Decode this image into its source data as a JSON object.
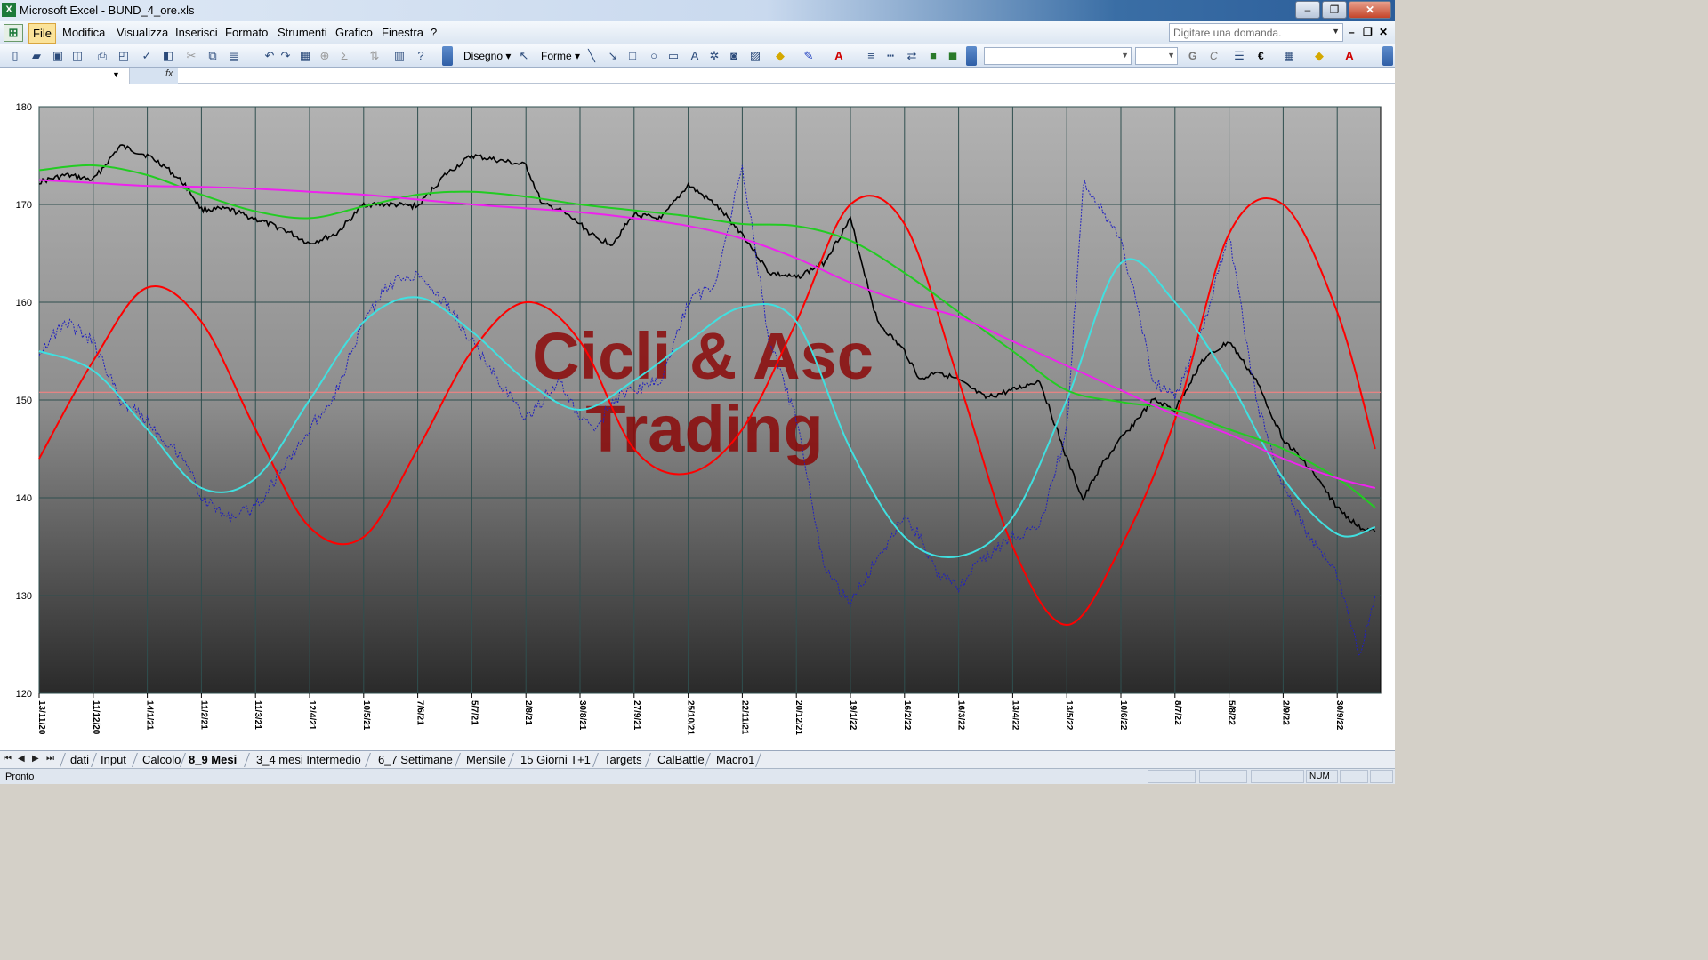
{
  "window": {
    "title": "Microsoft Excel - BUND_4_ore.xls",
    "minimize": "–",
    "restore": "❐",
    "close": "✕"
  },
  "menubar": {
    "items": [
      "File",
      "Modifica",
      "Visualizza",
      "Inserisci",
      "Formato",
      "Strumenti",
      "Grafico",
      "Finestra",
      "?"
    ],
    "help_placeholder": "Digitare una domanda.",
    "doc_min": "–",
    "doc_restore": "❐",
    "doc_close": "✕"
  },
  "toolbar": {
    "disegno_label": "Disegno",
    "forme_label": "Forme",
    "icons": [
      "new-icon",
      "open-icon",
      "save-icon",
      "permission-icon",
      "print-icon",
      "print-preview-icon",
      "spelling-icon",
      "research-icon",
      "cut-icon",
      "copy-icon",
      "paste-icon",
      "undo-icon",
      "redo-icon",
      "chart-object-icon",
      "hyperlink-icon",
      "autosum-icon",
      "sort-icon",
      "chart-wizard-icon",
      "help-icon"
    ],
    "bold_label": "G",
    "italic_label": "C",
    "euro_label": "€"
  },
  "formula_bar": {
    "fx_label": "fx"
  },
  "chart_data": {
    "type": "line",
    "title": "",
    "watermark": [
      "Cicli & Asc",
      "Trading"
    ],
    "ylim": [
      120,
      180
    ],
    "yticks": [
      120,
      130,
      140,
      150,
      160,
      170,
      180
    ],
    "xlabel": "",
    "ylabel": "",
    "x_tick_labels": [
      "13/11/20",
      "11/12/20",
      "14/1/21",
      "11/2/21",
      "11/3/21",
      "12/4/21",
      "10/5/21",
      "7/6/21",
      "5/7/21",
      "2/8/21",
      "30/8/21",
      "27/9/21",
      "25/10/21",
      "22/11/21",
      "20/12/21",
      "19/1/22",
      "16/2/22",
      "16/3/22",
      "13/4/22",
      "13/5/22",
      "10/6/22",
      "8/7/22",
      "5/8/22",
      "2/9/22",
      "30/9/22"
    ],
    "reference_line": {
      "name": "level",
      "value": 150.8,
      "color": "#ff8080"
    },
    "grid": true,
    "series": [
      {
        "color": "#000000",
        "style": "price",
        "x": [
          0,
          0.5,
          1,
          1.5,
          2,
          2.3,
          2.7,
          3,
          3.5,
          4,
          4.5,
          5,
          5.5,
          6,
          6.5,
          7,
          7.5,
          8,
          8.5,
          9,
          9.3,
          9.6,
          10,
          10.3,
          10.6,
          11,
          11.5,
          12,
          12.5,
          13,
          13.5,
          14,
          14.5,
          15,
          15.5,
          16,
          16.3,
          16.6,
          17,
          17.5,
          18,
          18.5,
          19,
          19.3,
          19.6,
          20,
          20.3,
          20.6,
          21,
          21.5,
          22,
          22.5,
          23,
          23.5,
          24,
          24.4,
          24.7
        ],
        "values": [
          172.3,
          173,
          172.5,
          176,
          175,
          174,
          172,
          169.5,
          169.5,
          168.5,
          167.5,
          166,
          167,
          170,
          170,
          169.8,
          173,
          175,
          174.5,
          174,
          170,
          169.5,
          168,
          166.5,
          166,
          169,
          168.5,
          172,
          170,
          167,
          163,
          162.5,
          164,
          168.5,
          158,
          155,
          152,
          153,
          152,
          150.2,
          151,
          152,
          144,
          139.8,
          143,
          146,
          148,
          150,
          149,
          154,
          156,
          152,
          146,
          143,
          139,
          137,
          136.5
        ]
      },
      {
        "color": "#2020c0",
        "style": "dotted-oscillator",
        "x": [
          0,
          0.5,
          1,
          1.5,
          2,
          2.3,
          2.7,
          3,
          3.5,
          4,
          4.5,
          5,
          5.5,
          6,
          6.5,
          7,
          7.5,
          8,
          8.5,
          9,
          9.3,
          9.6,
          10,
          10.3,
          10.6,
          11,
          11.5,
          12,
          12.5,
          13,
          13.5,
          14,
          14.5,
          15,
          15.5,
          16,
          16.3,
          16.6,
          17,
          17.5,
          18,
          18.5,
          19,
          19.3,
          19.6,
          20,
          20.3,
          20.6,
          21,
          21.5,
          22,
          22.5,
          23,
          23.5,
          24,
          24.4,
          24.7
        ],
        "values": [
          155,
          158,
          156,
          150,
          148,
          146,
          144,
          140,
          138,
          139,
          143,
          147,
          151,
          158,
          162,
          163,
          160,
          156,
          152,
          148,
          150,
          152,
          148,
          147,
          150,
          151,
          152,
          160,
          162,
          174,
          156,
          148,
          133,
          129,
          134,
          138,
          136,
          132,
          131,
          134,
          136,
          137,
          147,
          172,
          170,
          166,
          160,
          152,
          150,
          157,
          167,
          150,
          141,
          136,
          132,
          124,
          130
        ]
      },
      {
        "color": "#ff0000",
        "style": "cycle",
        "x": [
          0,
          1,
          2,
          3,
          4,
          5,
          6,
          7,
          8,
          9,
          10,
          11,
          12,
          13,
          14,
          15,
          16,
          17,
          18,
          19,
          20,
          21,
          22,
          23,
          24,
          24.7
        ],
        "values": [
          144,
          154,
          161.5,
          158,
          147,
          137,
          136,
          145,
          155,
          160,
          156,
          145,
          142.5,
          147,
          158,
          170,
          168,
          152,
          135,
          127,
          135,
          148,
          167,
          170,
          159,
          145
        ]
      },
      {
        "color": "#40e0e0",
        "style": "smooth",
        "x": [
          0,
          1,
          2,
          3,
          4,
          5,
          6,
          7,
          8,
          9,
          10,
          11,
          12,
          13,
          14,
          15,
          16,
          17,
          18,
          19,
          20,
          21,
          22,
          23,
          24,
          24.7
        ],
        "values": [
          155,
          153,
          147,
          141,
          142,
          150,
          158,
          160.5,
          157,
          152,
          149,
          152,
          156,
          159.5,
          158,
          145,
          136,
          134,
          138,
          150,
          164,
          160,
          152,
          142,
          136.3,
          137
        ]
      },
      {
        "color": "#22cc22",
        "style": "smooth",
        "x": [
          0,
          1,
          2,
          3,
          4,
          5,
          6,
          7,
          8,
          9,
          10,
          11,
          12,
          13,
          14,
          15,
          16,
          17,
          18,
          19,
          20,
          21,
          22,
          23,
          24,
          24.7
        ],
        "values": [
          173.5,
          174,
          173,
          171,
          169.3,
          168.6,
          169.8,
          171,
          171.3,
          170.8,
          170,
          169.4,
          168.8,
          168,
          167.8,
          166.3,
          163,
          159,
          155,
          151,
          149.8,
          149,
          147,
          145,
          142,
          139
        ]
      },
      {
        "color": "#ee22ee",
        "style": "smooth",
        "x": [
          0,
          1,
          2,
          3,
          4,
          5,
          6,
          7,
          8,
          9,
          10,
          11,
          12,
          13,
          14,
          15,
          16,
          17,
          18,
          19,
          20,
          21,
          22,
          23,
          24,
          24.7
        ],
        "values": [
          172.5,
          172.2,
          171.9,
          171.8,
          171.6,
          171.3,
          171,
          170.5,
          170,
          169.6,
          169.2,
          168.6,
          167.8,
          166.5,
          164.5,
          162,
          160,
          158.5,
          156,
          153.5,
          151,
          148.5,
          146.5,
          144,
          142,
          141
        ]
      }
    ]
  },
  "sheet_tabs": {
    "nav": [
      "⏮",
      "◀",
      "▶",
      "⏭"
    ],
    "tabs": [
      "dati",
      "Input",
      "Calcolo",
      "8_9 Mesi",
      "3_4 mesi Intermedio",
      "6_7 Settimane",
      "Mensile",
      "15 Giorni T+1",
      "Targets",
      "CalBattle",
      "Macro1"
    ],
    "active": "8_9 Mesi"
  },
  "statusbar": {
    "text": "Pronto",
    "num": "NUM"
  }
}
